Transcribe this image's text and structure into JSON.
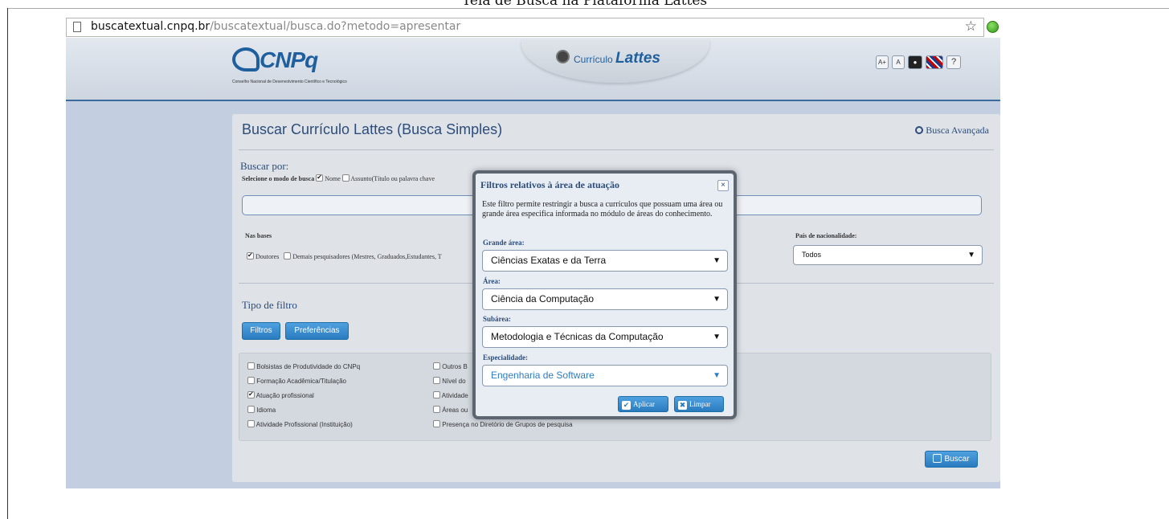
{
  "caption": "Tela de Busca na Plataforma Lattes",
  "browser": {
    "url_host": "buscatextual.cnpq.br",
    "url_path": "/buscatextual/busca.do?metodo=apresentar",
    "bookmark_icon": "star-icon",
    "page_icon": "page-icon",
    "extension_icon": "green-dot-icon"
  },
  "header": {
    "logo_text": "CNPq",
    "logo_subtitle": "Conselho Nacional de Desenvolvimento Científico e Tecnológico",
    "lattes_prefix": "Currículo",
    "lattes_name": "Lattes",
    "tools": [
      "A+",
      "A",
      "",
      "",
      "?"
    ]
  },
  "page": {
    "title": "Buscar Currículo Lattes (Busca Simples)",
    "advanced_link": "Busca Avançada",
    "buscar_por": "Buscar por:",
    "modo_label": "Selecione o modo de busca",
    "modo_options": [
      {
        "label": "Nome",
        "checked": true
      },
      {
        "label": "Assunto(Título ou palavra chave",
        "checked": false
      }
    ],
    "nas_bases": "Nas bases",
    "bases": [
      {
        "label": "Doutores",
        "checked": true
      },
      {
        "label": "Demais pesquisadores (Mestres, Graduados,Estudantes, T",
        "checked": false
      }
    ],
    "pais_label": "País de nacionalidade:",
    "pais_value": "Todos",
    "tipo_filtro": "Tipo de filtro",
    "btn_filtros": "Filtros",
    "btn_preferencias": "Preferências",
    "filters_col1": [
      {
        "label": "Bolsistas de Produtividade do CNPq",
        "checked": false
      },
      {
        "label": "Formação Acadêmica/Titulação",
        "checked": false
      },
      {
        "label": "Atuação profissional",
        "checked": true
      },
      {
        "label": "Idioma",
        "checked": false
      },
      {
        "label": "Atividade Profissional (Instituição)",
        "checked": false
      }
    ],
    "filters_col2": [
      {
        "label": "Outros B",
        "checked": false
      },
      {
        "label": "Nível do",
        "checked": false
      },
      {
        "label": "Atividade",
        "checked": false
      },
      {
        "label": "Áreas ou",
        "checked": false
      },
      {
        "label": "Presença no Diretório de Grupos de pesquisa",
        "checked": false
      }
    ],
    "btn_buscar": "Buscar"
  },
  "modal": {
    "title": "Filtros relativos à área de atuação",
    "close": "×",
    "description": "Este filtro permite restringir a busca a currículos que possuam uma área ou grande área especifica informada no módulo de áreas do conhecimento.",
    "grande_area_label": "Grande área:",
    "grande_area_value": "Ciências Exatas e da Terra",
    "area_label": "Área:",
    "area_value": "Ciência da Computação",
    "subarea_label": "Subárea:",
    "subarea_value": "Metodologia e Técnicas da Computação",
    "especialidade_label": "Especialidade:",
    "especialidade_value": "Engenharia de Software",
    "btn_aplicar": "Aplicar",
    "btn_limpar": "Limpar"
  }
}
